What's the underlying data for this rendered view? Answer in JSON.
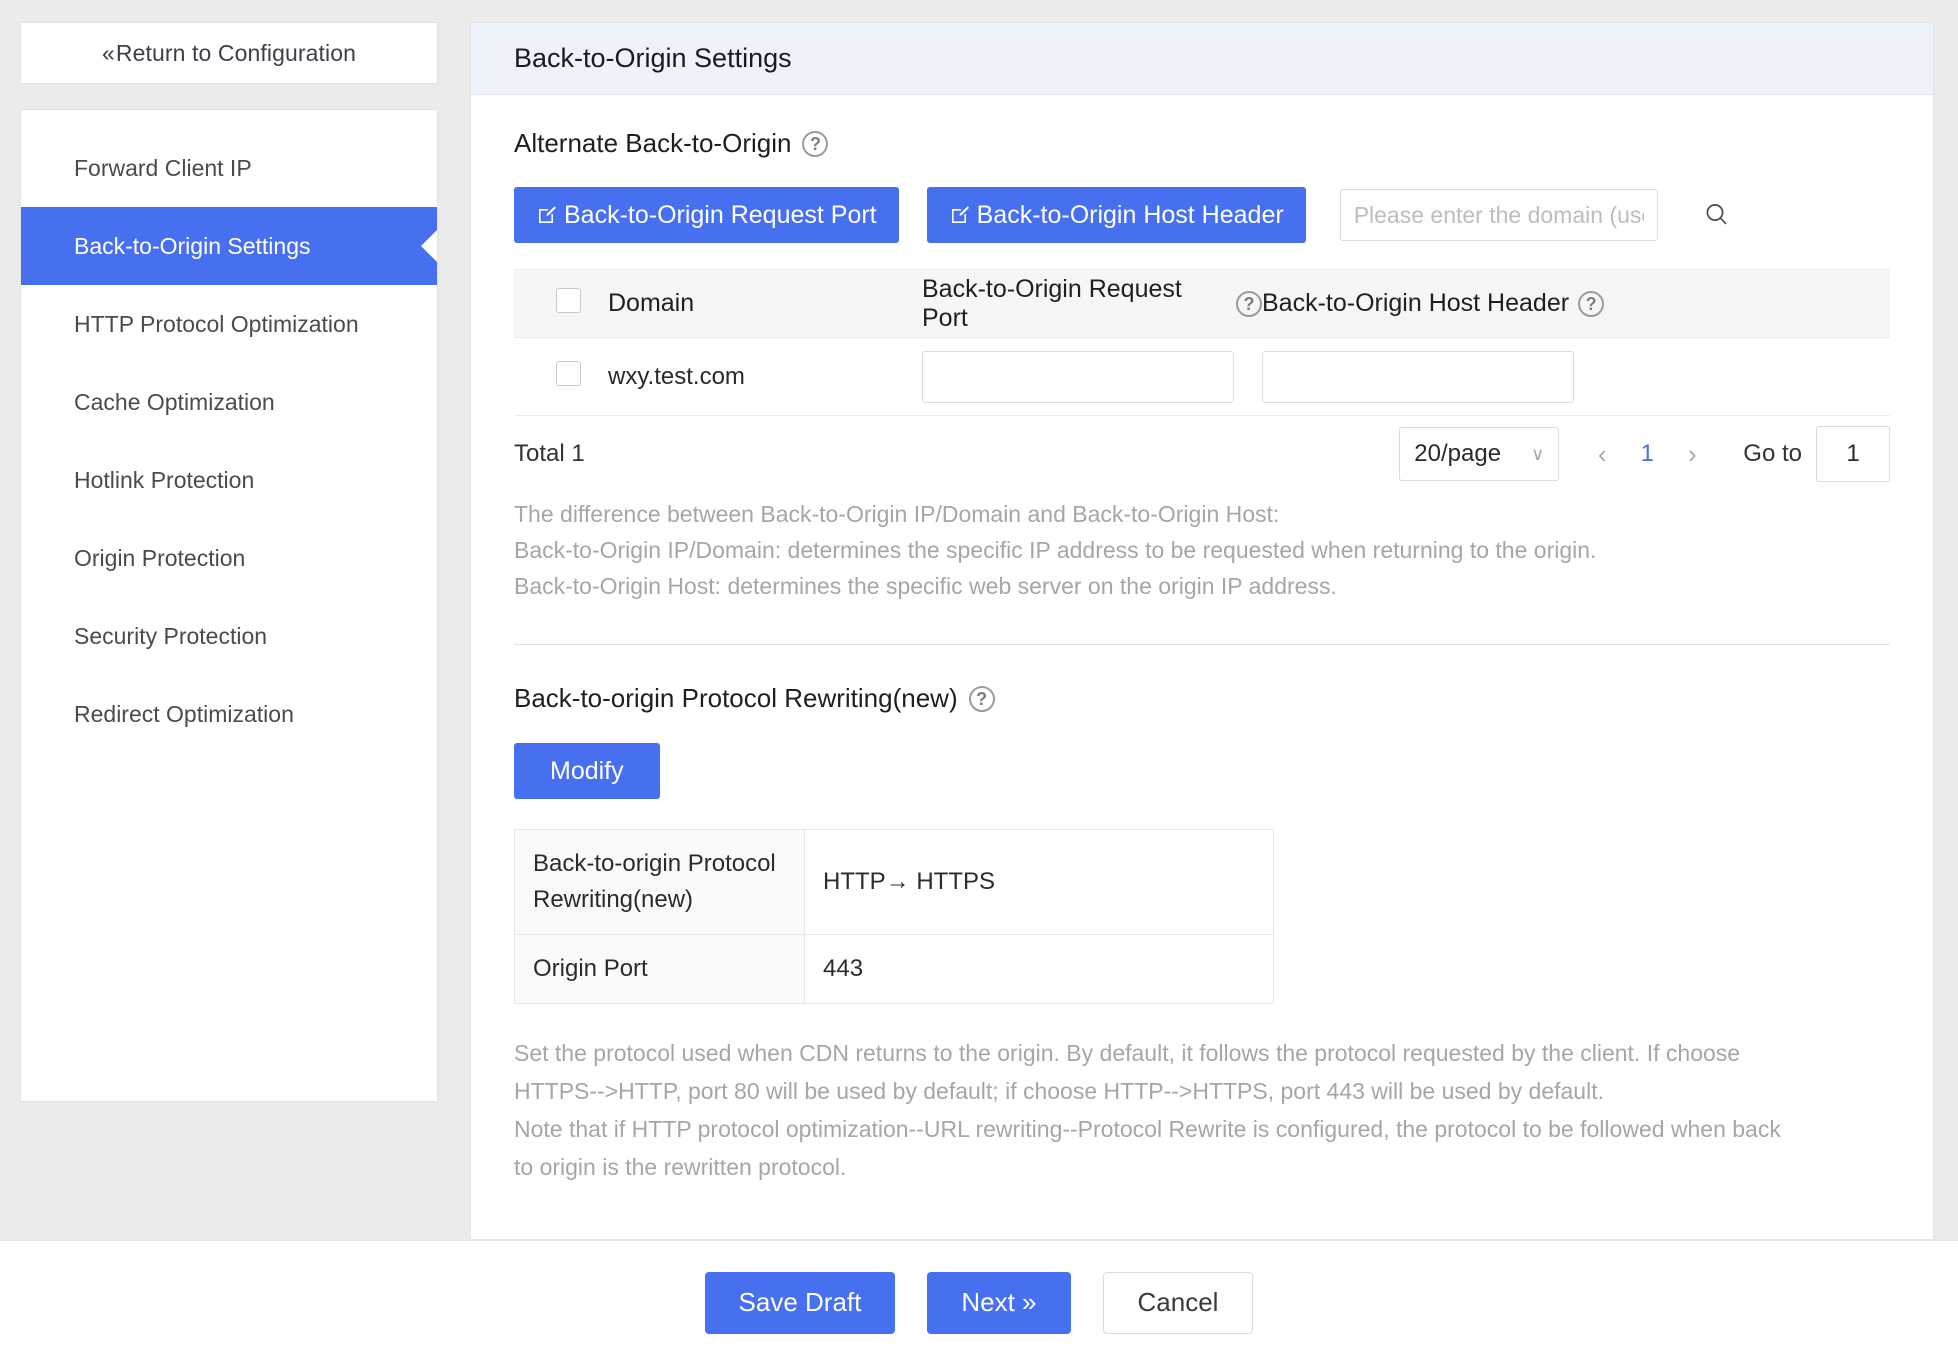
{
  "sidebar": {
    "return_label": "Return to Configuration",
    "return_chevron": "«",
    "items": [
      {
        "label": "Forward Client IP",
        "active": false
      },
      {
        "label": "Back-to-Origin Settings",
        "active": true
      },
      {
        "label": "HTTP Protocol Optimization",
        "active": false
      },
      {
        "label": "Cache Optimization",
        "active": false
      },
      {
        "label": "Hotlink Protection",
        "active": false
      },
      {
        "label": "Origin Protection",
        "active": false
      },
      {
        "label": "Security Protection",
        "active": false
      },
      {
        "label": "Redirect Optimization",
        "active": false
      }
    ]
  },
  "main": {
    "header_title": "Back-to-Origin Settings",
    "alternate_section": {
      "title": "Alternate Back-to-Origin",
      "help": "?",
      "buttons": [
        {
          "label": "Back-to-Origin Request Port",
          "icon": "edit-square-icon"
        },
        {
          "label": "Back-to-Origin Host Header",
          "icon": "edit-square-icon"
        }
      ],
      "search": {
        "placeholder": "Please enter the domain (use",
        "value": "",
        "icon": "search-icon"
      },
      "table": {
        "columns": [
          "",
          "Domain",
          "Back-to-Origin Request Port",
          "Back-to-Origin Host Header"
        ],
        "col_help": [
          "",
          "",
          "?",
          "?"
        ],
        "rows": [
          {
            "checked": false,
            "domain": "wxy.test.com",
            "port": "",
            "host": ""
          }
        ]
      },
      "pagination": {
        "total_label": "Total 1",
        "page_size": "20/page",
        "page_size_chevron": "∨",
        "prev": "‹",
        "current_page": "1",
        "next": "›",
        "goto_label": "Go to",
        "goto_value": "1"
      },
      "notes": [
        "The difference between Back-to-Origin IP/Domain and Back-to-Origin Host:",
        "Back-to-Origin IP/Domain: determines the specific IP address to be requested when returning to the origin.",
        "Back-to-Origin Host: determines the specific web server on the origin IP address."
      ]
    },
    "rewrite_section": {
      "title": "Back-to-origin Protocol Rewriting(new)",
      "help": "?",
      "modify_label": "Modify",
      "table_rows": [
        {
          "label": "Back-to-origin Protocol Rewriting(new)",
          "value": "HTTP→ HTTPS"
        },
        {
          "label": "Origin Port",
          "value": "443"
        }
      ],
      "description": [
        "Set the protocol used when CDN returns to the origin. By default, it follows the protocol requested by the client. If choose",
        "HTTPS-->HTTP, port 80 will be used by default; if choose HTTP-->HTTPS, port 443 will be used by default.",
        "Note that if HTTP protocol optimization--URL rewriting--Protocol Rewrite is configured, the protocol to be followed when back",
        "to origin is the rewritten protocol."
      ]
    }
  },
  "footer": {
    "save_draft_label": "Save Draft",
    "next_label": "Next »",
    "cancel_label": "Cancel"
  },
  "colors": {
    "accent": "#4770f0",
    "header_band": "#eef2fb",
    "page_bg": "#ebebeb",
    "muted_text": "#a6a6a6"
  }
}
